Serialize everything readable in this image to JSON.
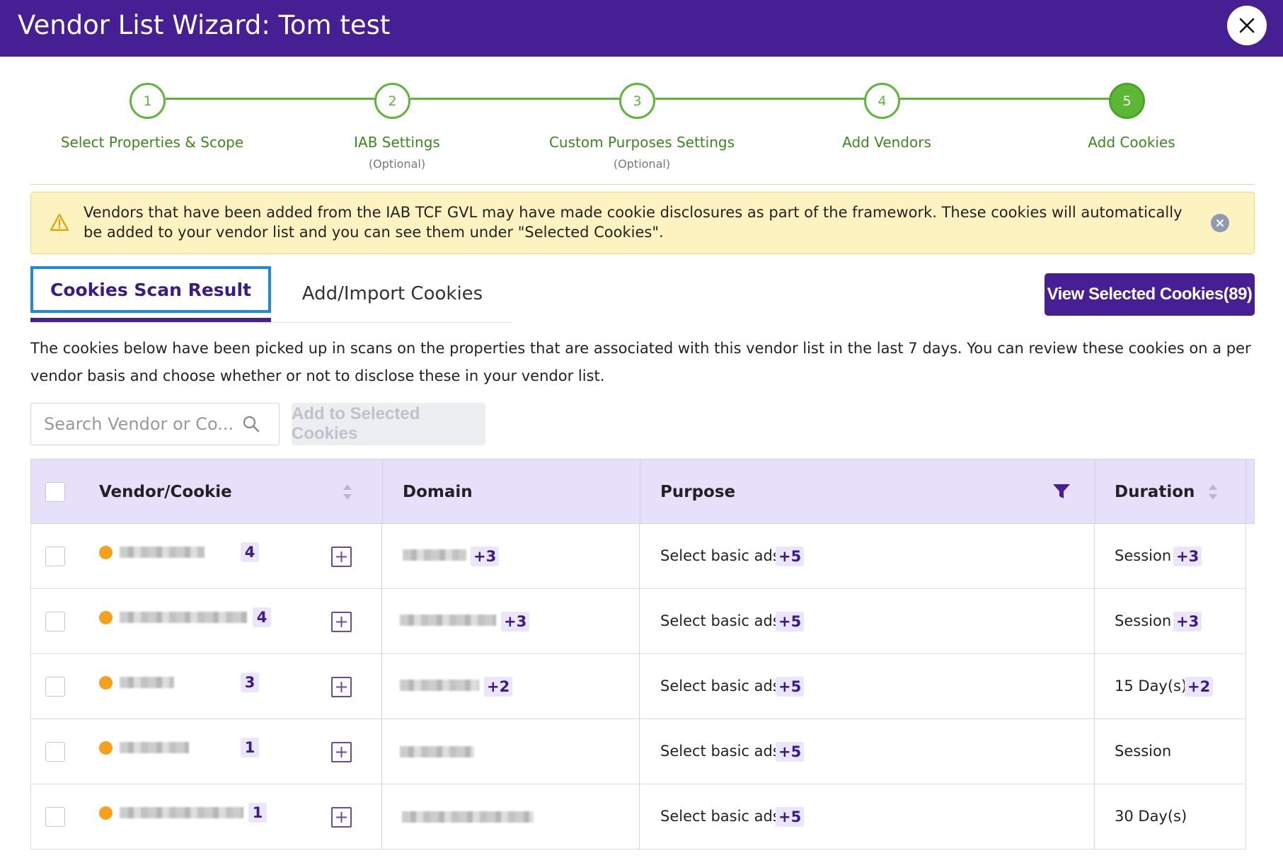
{
  "window": {
    "title": "Vendor List Wizard: Tom test"
  },
  "icons": {
    "close": "close-icon",
    "warning": "warning-icon",
    "search": "search-icon",
    "filter": "filter-icon",
    "sort": "sort-icon",
    "plus": "plus-icon"
  },
  "colors": {
    "brand": "#461f94",
    "step_green": "#5cb734",
    "alert_bg": "#fdf3c0",
    "vendor_dot": "#f7a11a",
    "tab_focus": "#1e88e5"
  },
  "stepper": {
    "current_step": 5,
    "steps": [
      {
        "number": "1",
        "label": "Select Properties & Scope",
        "sub": ""
      },
      {
        "number": "2",
        "label": "IAB Settings",
        "sub": "(Optional)"
      },
      {
        "number": "3",
        "label": "Custom Purposes Settings",
        "sub": "(Optional)"
      },
      {
        "number": "4",
        "label": "Add Vendors",
        "sub": ""
      },
      {
        "number": "5",
        "label": "Add Cookies",
        "sub": ""
      }
    ]
  },
  "alert": {
    "text": "Vendors that have been added from the IAB TCF GVL may have made cookie disclosures as part of the framework. These cookies will automatically be added to your vendor list and you can see them under \"Selected Cookies\"."
  },
  "tabs": {
    "items": [
      {
        "label": "Cookies Scan Result",
        "active": true
      },
      {
        "label": "Add/Import Cookies",
        "active": false
      }
    ],
    "view_selected_label": "View Selected Cookies(89)"
  },
  "description": "The cookies below have been picked up in scans on the properties that are associated with this vendor list in the last 7 days. You can review these cookies on a per vendor basis and choose whether or not to disclose these in your vendor list.",
  "search": {
    "placeholder": "Search Vendor or Co..."
  },
  "add_selected_label": "Add to Selected Cookies",
  "table": {
    "columns": {
      "vendor": "Vendor/Cookie",
      "domain": "Domain",
      "purpose": "Purpose",
      "duration": "Duration"
    },
    "rows": [
      {
        "count": "4",
        "domain_more": "+3",
        "purpose": "Select basic ads",
        "purpose_more": "+5",
        "duration": "Session",
        "duration_more": "+3"
      },
      {
        "count": "4",
        "domain_more": "+3",
        "purpose": "Select basic ads",
        "purpose_more": "+5",
        "duration": "Session",
        "duration_more": "+3"
      },
      {
        "count": "3",
        "domain_more": "+2",
        "purpose": "Select basic ads",
        "purpose_more": "+5",
        "duration": "15 Day(s)",
        "duration_more": "+2"
      },
      {
        "count": "1",
        "domain_more": "",
        "purpose": "Select basic ads",
        "purpose_more": "+5",
        "duration": "Session",
        "duration_more": ""
      },
      {
        "count": "1",
        "domain_more": "",
        "purpose": "Select basic ads",
        "purpose_more": "+5",
        "duration": "30 Day(s)",
        "duration_more": ""
      }
    ]
  }
}
